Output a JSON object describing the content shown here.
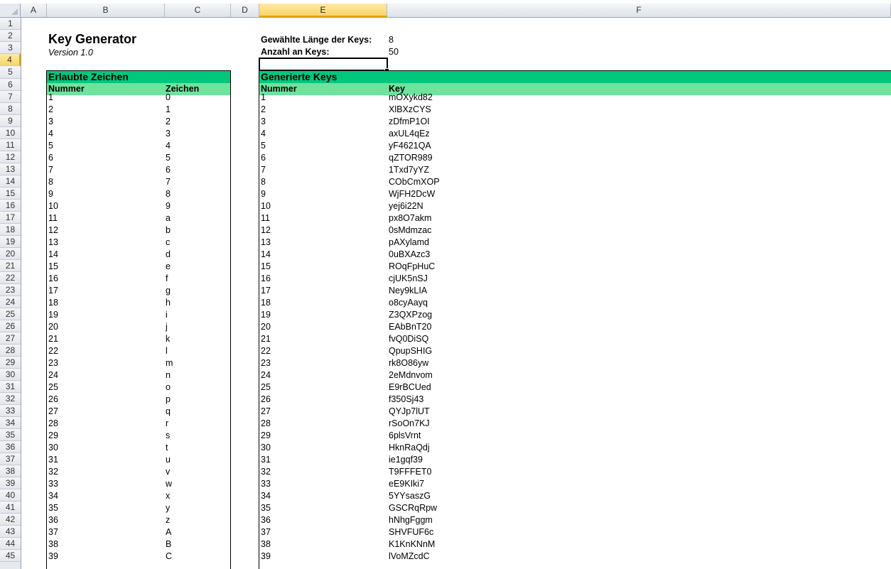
{
  "columns": [
    "A",
    "B",
    "C",
    "D",
    "E",
    "F"
  ],
  "rows": [
    "1",
    "2",
    "3",
    "4",
    "5",
    "6",
    "7",
    "8",
    "9",
    "10",
    "11",
    "12",
    "13",
    "14",
    "15",
    "16",
    "17",
    "18",
    "19",
    "20",
    "21",
    "22",
    "23",
    "24",
    "25",
    "26",
    "27",
    "28",
    "29",
    "30",
    "31",
    "32",
    "33",
    "34",
    "35",
    "36",
    "37",
    "38",
    "39",
    "40",
    "41",
    "42",
    "43",
    "44",
    "45"
  ],
  "selected_cell": "E4",
  "header": {
    "title": "Key Generator",
    "version": "Version 1.0",
    "length_label": "Gewählte Länge der Keys:",
    "length_value": "8",
    "count_label": "Anzahl an Keys:",
    "count_value": "50"
  },
  "allowed": {
    "title": "Erlaubte Zeichen",
    "col1": "Nummer",
    "col2": "Zeichen",
    "rows": [
      [
        "1",
        "0"
      ],
      [
        "2",
        "1"
      ],
      [
        "3",
        "2"
      ],
      [
        "4",
        "3"
      ],
      [
        "5",
        "4"
      ],
      [
        "6",
        "5"
      ],
      [
        "7",
        "6"
      ],
      [
        "8",
        "7"
      ],
      [
        "9",
        "8"
      ],
      [
        "10",
        "9"
      ],
      [
        "11",
        "a"
      ],
      [
        "12",
        "b"
      ],
      [
        "13",
        "c"
      ],
      [
        "14",
        "d"
      ],
      [
        "15",
        "e"
      ],
      [
        "16",
        "f"
      ],
      [
        "17",
        "g"
      ],
      [
        "18",
        "h"
      ],
      [
        "19",
        "i"
      ],
      [
        "20",
        "j"
      ],
      [
        "21",
        "k"
      ],
      [
        "22",
        "l"
      ],
      [
        "23",
        "m"
      ],
      [
        "24",
        "n"
      ],
      [
        "25",
        "o"
      ],
      [
        "26",
        "p"
      ],
      [
        "27",
        "q"
      ],
      [
        "28",
        "r"
      ],
      [
        "29",
        "s"
      ],
      [
        "30",
        "t"
      ],
      [
        "31",
        "u"
      ],
      [
        "32",
        "v"
      ],
      [
        "33",
        "w"
      ],
      [
        "34",
        "x"
      ],
      [
        "35",
        "y"
      ],
      [
        "36",
        "z"
      ],
      [
        "37",
        "A"
      ],
      [
        "38",
        "B"
      ],
      [
        "39",
        "C"
      ]
    ]
  },
  "generated": {
    "title": "Generierte Keys",
    "col1": "Nummer",
    "col2": "Key",
    "rows": [
      [
        "1",
        "mOXykd82"
      ],
      [
        "2",
        "XlBXzCYS"
      ],
      [
        "3",
        "zDfmP1OI"
      ],
      [
        "4",
        "axUL4qEz"
      ],
      [
        "5",
        "yF4621QA"
      ],
      [
        "6",
        "qZTOR989"
      ],
      [
        "7",
        "1Txd7yYZ"
      ],
      [
        "8",
        "CObCmXOP"
      ],
      [
        "9",
        "WjFH2DcW"
      ],
      [
        "10",
        "yej6i22N"
      ],
      [
        "11",
        "px8O7akm"
      ],
      [
        "12",
        "0sMdmzac"
      ],
      [
        "13",
        "pAXylamd"
      ],
      [
        "14",
        "0uBXAzc3"
      ],
      [
        "15",
        "ROqFpHuC"
      ],
      [
        "16",
        "cjUK5nSJ"
      ],
      [
        "17",
        "Ney9kLIA"
      ],
      [
        "18",
        "o8cyAayq"
      ],
      [
        "19",
        "Z3QXPzog"
      ],
      [
        "20",
        "EAbBnT20"
      ],
      [
        "21",
        "fvQ0DiSQ"
      ],
      [
        "22",
        "QpupSHIG"
      ],
      [
        "23",
        "rk8O86yw"
      ],
      [
        "24",
        "2eMdnvom"
      ],
      [
        "25",
        "E9rBCUed"
      ],
      [
        "26",
        "f350Sj43"
      ],
      [
        "27",
        "QYJp7lUT"
      ],
      [
        "28",
        "rSoOn7KJ"
      ],
      [
        "29",
        "6plsVrnt"
      ],
      [
        "30",
        "HknRaQdj"
      ],
      [
        "31",
        "ie1gqf39"
      ],
      [
        "32",
        "T9FFFET0"
      ],
      [
        "33",
        "eE9KIki7"
      ],
      [
        "34",
        "5YYsaszG"
      ],
      [
        "35",
        "GSCRqRpw"
      ],
      [
        "36",
        "hNhgFggm"
      ],
      [
        "37",
        "SHVFUF6c"
      ],
      [
        "38",
        "K1KnKNnM"
      ],
      [
        "39",
        "lVoMZcdC"
      ]
    ]
  }
}
